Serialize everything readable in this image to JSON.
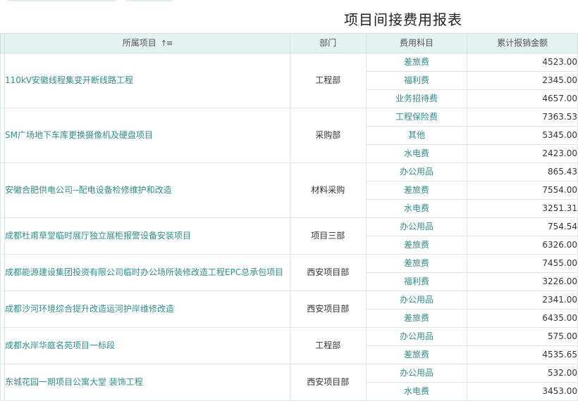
{
  "report": {
    "title": "项目间接费用报表"
  },
  "table": {
    "headers": {
      "project": "所属项目",
      "sort_icon": "↑≡",
      "department": "部门",
      "category": "费用科目",
      "amount": "累计报销金额"
    },
    "groups": [
      {
        "project": "110kV安徽线程集变开断线路工程",
        "department": "工程部",
        "items": [
          {
            "category": "差旅费",
            "amount": "4523.00"
          },
          {
            "category": "福利费",
            "amount": "2345.00"
          },
          {
            "category": "业务招待费",
            "amount": "4657.00"
          }
        ]
      },
      {
        "project": "SM广场地下车库更换摄像机及硬盘项目",
        "department": "采购部",
        "items": [
          {
            "category": "工程保险费",
            "amount": "7363.53"
          },
          {
            "category": "其他",
            "amount": "5345.00"
          },
          {
            "category": "水电费",
            "amount": "2423.00"
          }
        ]
      },
      {
        "project": "安徽合肥供电公司--配电设备检修维护和改造",
        "department": "材料采购",
        "items": [
          {
            "category": "办公用品",
            "amount": "865.43"
          },
          {
            "category": "差旅费",
            "amount": "7554.00"
          },
          {
            "category": "水电费",
            "amount": "3251.31"
          }
        ]
      },
      {
        "project": "成都杜甫草堂临时展厅独立展柜报警设备安装项目",
        "department": "项目三部",
        "items": [
          {
            "category": "办公用品",
            "amount": "754.54"
          },
          {
            "category": "差旅费",
            "amount": "6326.00"
          }
        ]
      },
      {
        "project": "成都能源建设集团投资有限公司临时办公场所装修改造工程EPC总承包项目",
        "department": "西安项目部",
        "items": [
          {
            "category": "差旅费",
            "amount": "7455.00"
          },
          {
            "category": "福利费",
            "amount": "3226.00"
          }
        ]
      },
      {
        "project": "成都沙河环境综合提升改造运河护岸维修改造",
        "department": "西安项目部",
        "items": [
          {
            "category": "办公用品",
            "amount": "2341.00"
          },
          {
            "category": "差旅费",
            "amount": "6435.00"
          }
        ]
      },
      {
        "project": "成都水岸华庭名苑项目一标段",
        "department": "工程部",
        "items": [
          {
            "category": "办公用品",
            "amount": "575.00"
          },
          {
            "category": "差旅费",
            "amount": "4535.65"
          }
        ]
      },
      {
        "project": "东城花园一期项目公寓大堂 装饰工程",
        "department": "西安项目部",
        "items": [
          {
            "category": "办公用品",
            "amount": "532.00"
          },
          {
            "category": "水电费",
            "amount": "3453.00"
          }
        ]
      }
    ]
  }
}
